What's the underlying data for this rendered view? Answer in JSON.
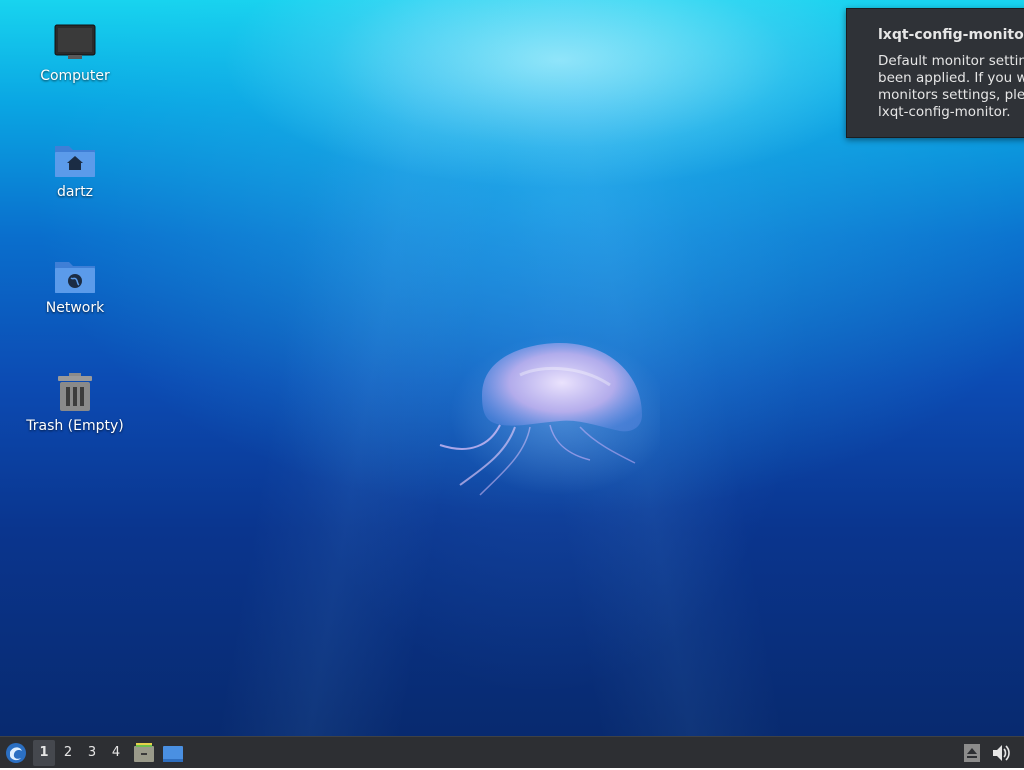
{
  "desktop": {
    "icons": [
      {
        "label": "Computer",
        "icon": "computer-monitor-icon"
      },
      {
        "label": "dartz",
        "icon": "home-folder-icon"
      },
      {
        "label": "Network",
        "icon": "network-folder-icon"
      },
      {
        "label": "Trash (Empty)",
        "icon": "trash-icon"
      }
    ]
  },
  "notification": {
    "title": "lxqt-config-monitor",
    "body": "Default monitor settin\nbeen applied. If you w\nmonitors settings, ple\nlxqt-config-monitor."
  },
  "taskbar": {
    "start_icon": "lxqt-menu-icon",
    "desktops": [
      "1",
      "2",
      "3",
      "4"
    ],
    "active_desktop": "1",
    "quicklaunch": [
      "file-manager-icon",
      "show-desktop-icon"
    ],
    "tray": [
      "eject-icon",
      "volume-icon"
    ]
  }
}
